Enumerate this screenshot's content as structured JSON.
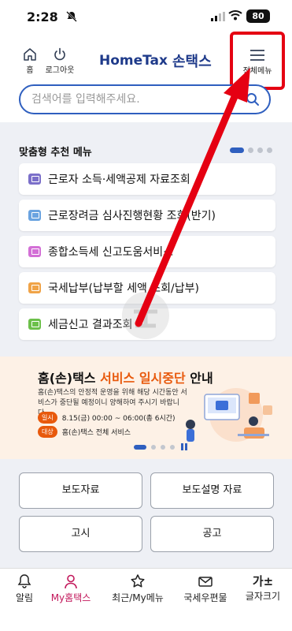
{
  "status_bar": {
    "time": "2:28",
    "battery": "80"
  },
  "header": {
    "home_label": "홈",
    "logout_label": "로그아웃",
    "logo_en": "HomeTax",
    "logo_ko": "손택스",
    "menu_label": "전체메뉴"
  },
  "search": {
    "placeholder": "검색어를 입력해주세요."
  },
  "recommend": {
    "title": "맞춤형 추천 메뉴",
    "items": [
      {
        "label": "근로자 소득·세액공제 자료조회",
        "icon_color": "#7b6fc9"
      },
      {
        "label": "근로장려금 심사진행현황 조회(반기)",
        "icon_color": "#6aa3e0"
      },
      {
        "label": "종합소득세 신고도움서비스",
        "icon_color": "#d36fd6"
      },
      {
        "label": "국세납부(납부할 세액 조회/납부)",
        "icon_color": "#f0a347"
      },
      {
        "label": "세금신고 결과조회",
        "icon_color": "#6cc04a"
      }
    ]
  },
  "banner": {
    "title_part1": "홈(손)택스",
    "title_highlight": "서비스 일시중단",
    "title_part2": "안내",
    "desc": "홈(손)택스의 안정적 운영을 위해 해당 시간동안 서비스가 중단될 예정이니 양해하여 주시기 바랍니다.",
    "tag1": "일시",
    "when": "8.15(금) 00:00 ~ 06:00(총 6시간)",
    "tag2": "대상",
    "target": "홈(손)택스 전체 서비스"
  },
  "links": {
    "b1": "보도자료",
    "b2": "보도설명 자료",
    "b3": "고시",
    "b4": "공고"
  },
  "bottom_nav": {
    "n1": "알림",
    "n2": "My홈택스",
    "n3": "최근/My메뉴",
    "n4": "국세우편물",
    "n5_glyph": "가±",
    "n5": "글자크기"
  },
  "colors": {
    "accent": "#2f5fbf",
    "highlight": "#e50012",
    "banner_orange": "#e8590c",
    "active_nav": "#c2185b"
  }
}
